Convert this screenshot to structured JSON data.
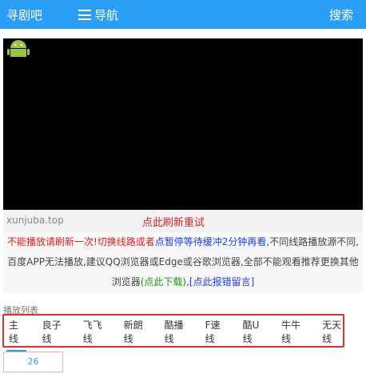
{
  "header": {
    "site_title": "寻剧吧",
    "nav_label": "导航",
    "search_label": "搜索"
  },
  "player": {
    "watermark": "xunjuba.top",
    "refresh_link": "点此刷新重试"
  },
  "notice": {
    "part1": "不能播放请刷新一次!切换线路或者",
    "part2": "点暂停等待缓冲2分钟再看",
    "part3": ",不同线路播放源不同,百度APP无法播放,建议QQ浏览器或Edge或谷歌浏览器,全部不能观看推荐更换其他浏览器",
    "part4": "(点此下载)",
    "part5": ",",
    "part6": "[点此报错留言]"
  },
  "playlist": {
    "label": "播放列表",
    "tabs": [
      "主线",
      "良子线",
      "飞飞线",
      "新朗线",
      "酷播线",
      "F速线",
      "酷U线",
      "牛牛线",
      "无天线"
    ],
    "active_tab": "主线"
  },
  "episodes": [
    "26"
  ],
  "colors": {
    "header_bg": "#2a9df4",
    "highlight_border": "#e53030"
  }
}
